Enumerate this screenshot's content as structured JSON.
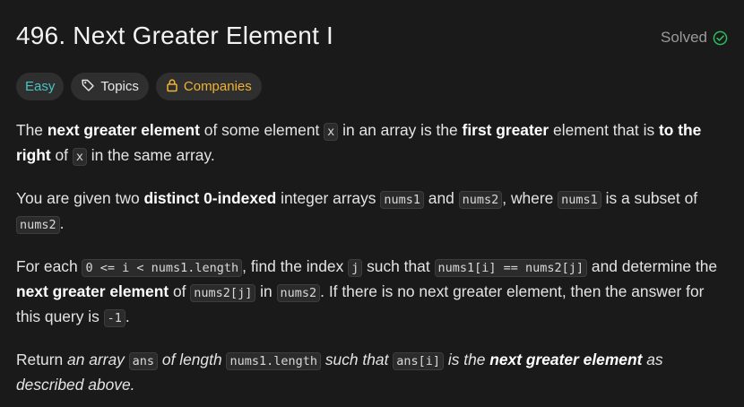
{
  "problem": {
    "title": "496. Next Greater Element I",
    "status": "Solved"
  },
  "tags": {
    "difficulty": "Easy",
    "topics": "Topics",
    "companies": "Companies"
  },
  "colors": {
    "difficulty_easy": "#46c6c2",
    "companies": "#f0b232",
    "solved_check": "#2cbb5d",
    "background": "#1a1a1a"
  },
  "icons": {
    "solved": "check-circle-icon",
    "topics": "tag-icon",
    "companies": "lock-icon"
  },
  "description": {
    "p1": {
      "t1": "The ",
      "b1": "next greater element",
      "t2": " of some element ",
      "c1": "x",
      "t3": " in an array is the ",
      "b2": "first greater",
      "t4": " element that is ",
      "b3": "to the right",
      "t5": " of ",
      "c2": "x",
      "t6": " in the same array."
    },
    "p2": {
      "t1": "You are given two ",
      "b1": "distinct 0-indexed",
      "t2": " integer arrays ",
      "c1": "nums1",
      "t3": " and ",
      "c2": "nums2",
      "t4": ", where ",
      "c3": "nums1",
      "t5": " is a subset of ",
      "c4": "nums2",
      "t6": "."
    },
    "p3": {
      "t1": "For each ",
      "c1": "0 <= i < nums1.length",
      "t2": ", find the index ",
      "c2": "j",
      "t3": " such that ",
      "c3": "nums1[i] == nums2[j]",
      "t4": " and determine the ",
      "b1": "next greater element",
      "t5": " of ",
      "c4": "nums2[j]",
      "t6": " in ",
      "c5": "nums2",
      "t7": ". If there is no next greater element, then the answer for this query is ",
      "c6": "-1",
      "t8": "."
    },
    "p4": {
      "t1": "Return ",
      "i1": "an array ",
      "c1": "ans",
      "i2": " of length ",
      "c2": "nums1.length",
      "i3": " such that ",
      "c3": "ans[i]",
      "i4": " is the ",
      "b1": "next greater element",
      "i5": " as described above."
    }
  }
}
